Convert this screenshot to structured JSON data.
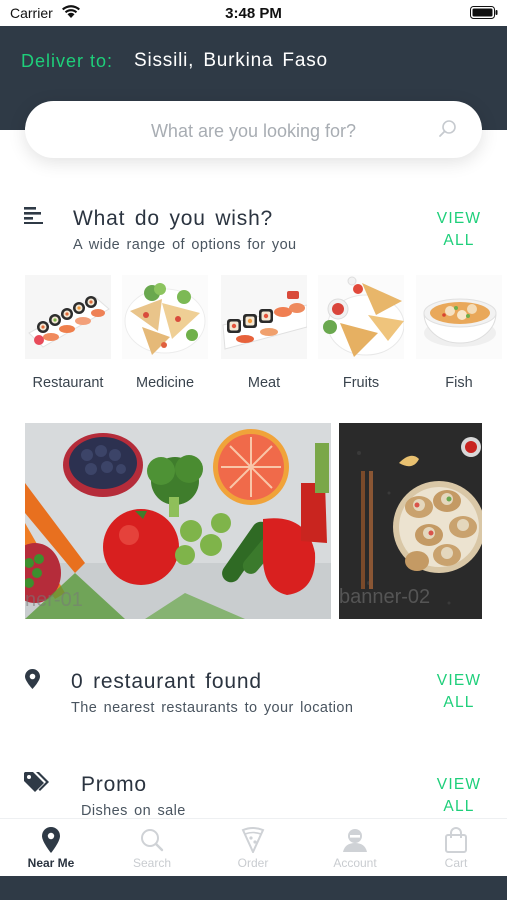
{
  "status": {
    "carrier": "Carrier",
    "time": "3:48 PM"
  },
  "header": {
    "deliver_label": "Deliver to:",
    "location": "Sissili, Burkina Faso"
  },
  "search": {
    "placeholder": "What are you looking for?"
  },
  "wish": {
    "title": "What do you wish?",
    "subtitle": "A wide range of options for you",
    "view_all": "VIEW ALL",
    "categories": [
      {
        "label": "Restaurant",
        "image": "sushi-platter"
      },
      {
        "label": "Medicine",
        "image": "quesadilla-plate"
      },
      {
        "label": "Meat",
        "image": "sushi-rolls"
      },
      {
        "label": "Fruits",
        "image": "quesadilla-wedges"
      },
      {
        "label": "Fish",
        "image": "soup-bowl"
      }
    ]
  },
  "banners": [
    {
      "caption": "ner-01",
      "image": "vegetables"
    },
    {
      "caption": "banner-02",
      "image": "spring-rolls"
    }
  ],
  "restaurants": {
    "title": "0 restaurant found",
    "subtitle": "The nearest restaurants to your location",
    "view_all": "VIEW ALL"
  },
  "promo": {
    "title": "Promo",
    "subtitle": "Dishes on sale",
    "view_all": "VIEW ALL"
  },
  "tabs": [
    {
      "label": "Near Me",
      "icon": "location-pin-icon",
      "active": true
    },
    {
      "label": "Search",
      "icon": "search-icon",
      "active": false
    },
    {
      "label": "Order",
      "icon": "pizza-slice-icon",
      "active": false
    },
    {
      "label": "Account",
      "icon": "user-icon",
      "active": false
    },
    {
      "label": "Cart",
      "icon": "shopping-bag-icon",
      "active": false
    }
  ],
  "colors": {
    "accent": "#1ecf7a",
    "header_bg": "#2f3a46",
    "text": "#2b3440"
  }
}
